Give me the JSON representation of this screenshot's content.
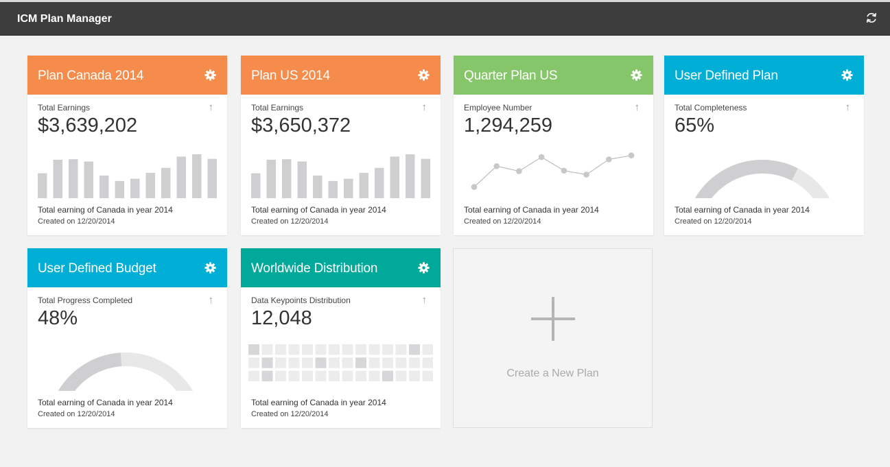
{
  "app": {
    "title": "ICM Plan Manager"
  },
  "cards": [
    {
      "title": "Plan Canada 2014",
      "header_color": "#f68c4c",
      "metric_label": "Total Earnings",
      "metric_value": "$3,639,202",
      "viz": "bar",
      "bar_values": [
        5.5,
        8.5,
        8.6,
        8.1,
        5.0,
        3.8,
        4.3,
        5.6,
        6.7,
        9.2,
        9.7,
        8.7
      ],
      "description": "Total earning of Canada in year 2014",
      "created": "Created on 12/20/2014"
    },
    {
      "title": "Plan US 2014",
      "header_color": "#f68c4c",
      "metric_label": "Total Earnings",
      "metric_value": "$3,650,372",
      "viz": "bar",
      "bar_values": [
        5.5,
        8.5,
        8.6,
        8.1,
        5.0,
        3.8,
        4.3,
        5.6,
        6.7,
        9.2,
        9.7,
        8.7
      ],
      "description": "Total earning of Canada in year 2014",
      "created": "Created on 12/20/2014"
    },
    {
      "title": "Quarter Plan US",
      "header_color": "#86c66a",
      "metric_label": "Employee Number",
      "metric_value": "1,294,259",
      "viz": "line",
      "line_values": [
        2.0,
        5.7,
        4.8,
        7.3,
        4.9,
        4.2,
        6.9,
        7.6
      ],
      "description": "Total earning of Canada in year 2014",
      "created": "Created on 12/20/2014"
    },
    {
      "title": "User Defined Plan",
      "header_color": "#00aed6",
      "metric_label": "Total Completeness",
      "metric_value": "65%",
      "viz": "gauge",
      "gauge_fraction": 0.65,
      "description": "Total earning of Canada in year 2014",
      "created": "Created on 12/20/2014"
    },
    {
      "title": "User Defined Budget",
      "header_color": "#00aed6",
      "metric_label": "Total Progress Completed",
      "metric_value": "48%",
      "viz": "gauge",
      "gauge_fraction": 0.48,
      "description": "Total earning of Canada in year 2014",
      "created": "Created on 12/20/2014"
    },
    {
      "title": "Worldwide Distribution",
      "header_color": "#00a99a",
      "metric_label": "Data Keypoints Distribution",
      "metric_value": "12,048",
      "viz": "grid",
      "grid_levels": [
        [
          2,
          1,
          1,
          1,
          1,
          1,
          1,
          1,
          1,
          1,
          1,
          1,
          2,
          1
        ],
        [
          1,
          2,
          1,
          1,
          1,
          2,
          1,
          1,
          2,
          1,
          1,
          1,
          1,
          1
        ],
        [
          1,
          2,
          1,
          1,
          1,
          1,
          1,
          1,
          1,
          1,
          2,
          1,
          1,
          1
        ]
      ],
      "description": "Total earning of Canada in year 2014",
      "created": "Created on 12/20/2014"
    }
  ],
  "new_plan": {
    "label": "Create a New Plan"
  },
  "icons": {
    "refresh": "refresh-icon",
    "gear": "gear-icon",
    "arrow": "arrow-up-icon",
    "plus": "plus-icon"
  },
  "colors": {
    "bar": "#cfcfd2",
    "line": "#bdbdbd",
    "point": "#c8c8c8",
    "gauge_filled": "#cfcfd2",
    "gauge_empty": "#e8e8e8",
    "grid_levels": [
      "#f0f0f0",
      "#ececec",
      "#d7d7d9"
    ]
  }
}
